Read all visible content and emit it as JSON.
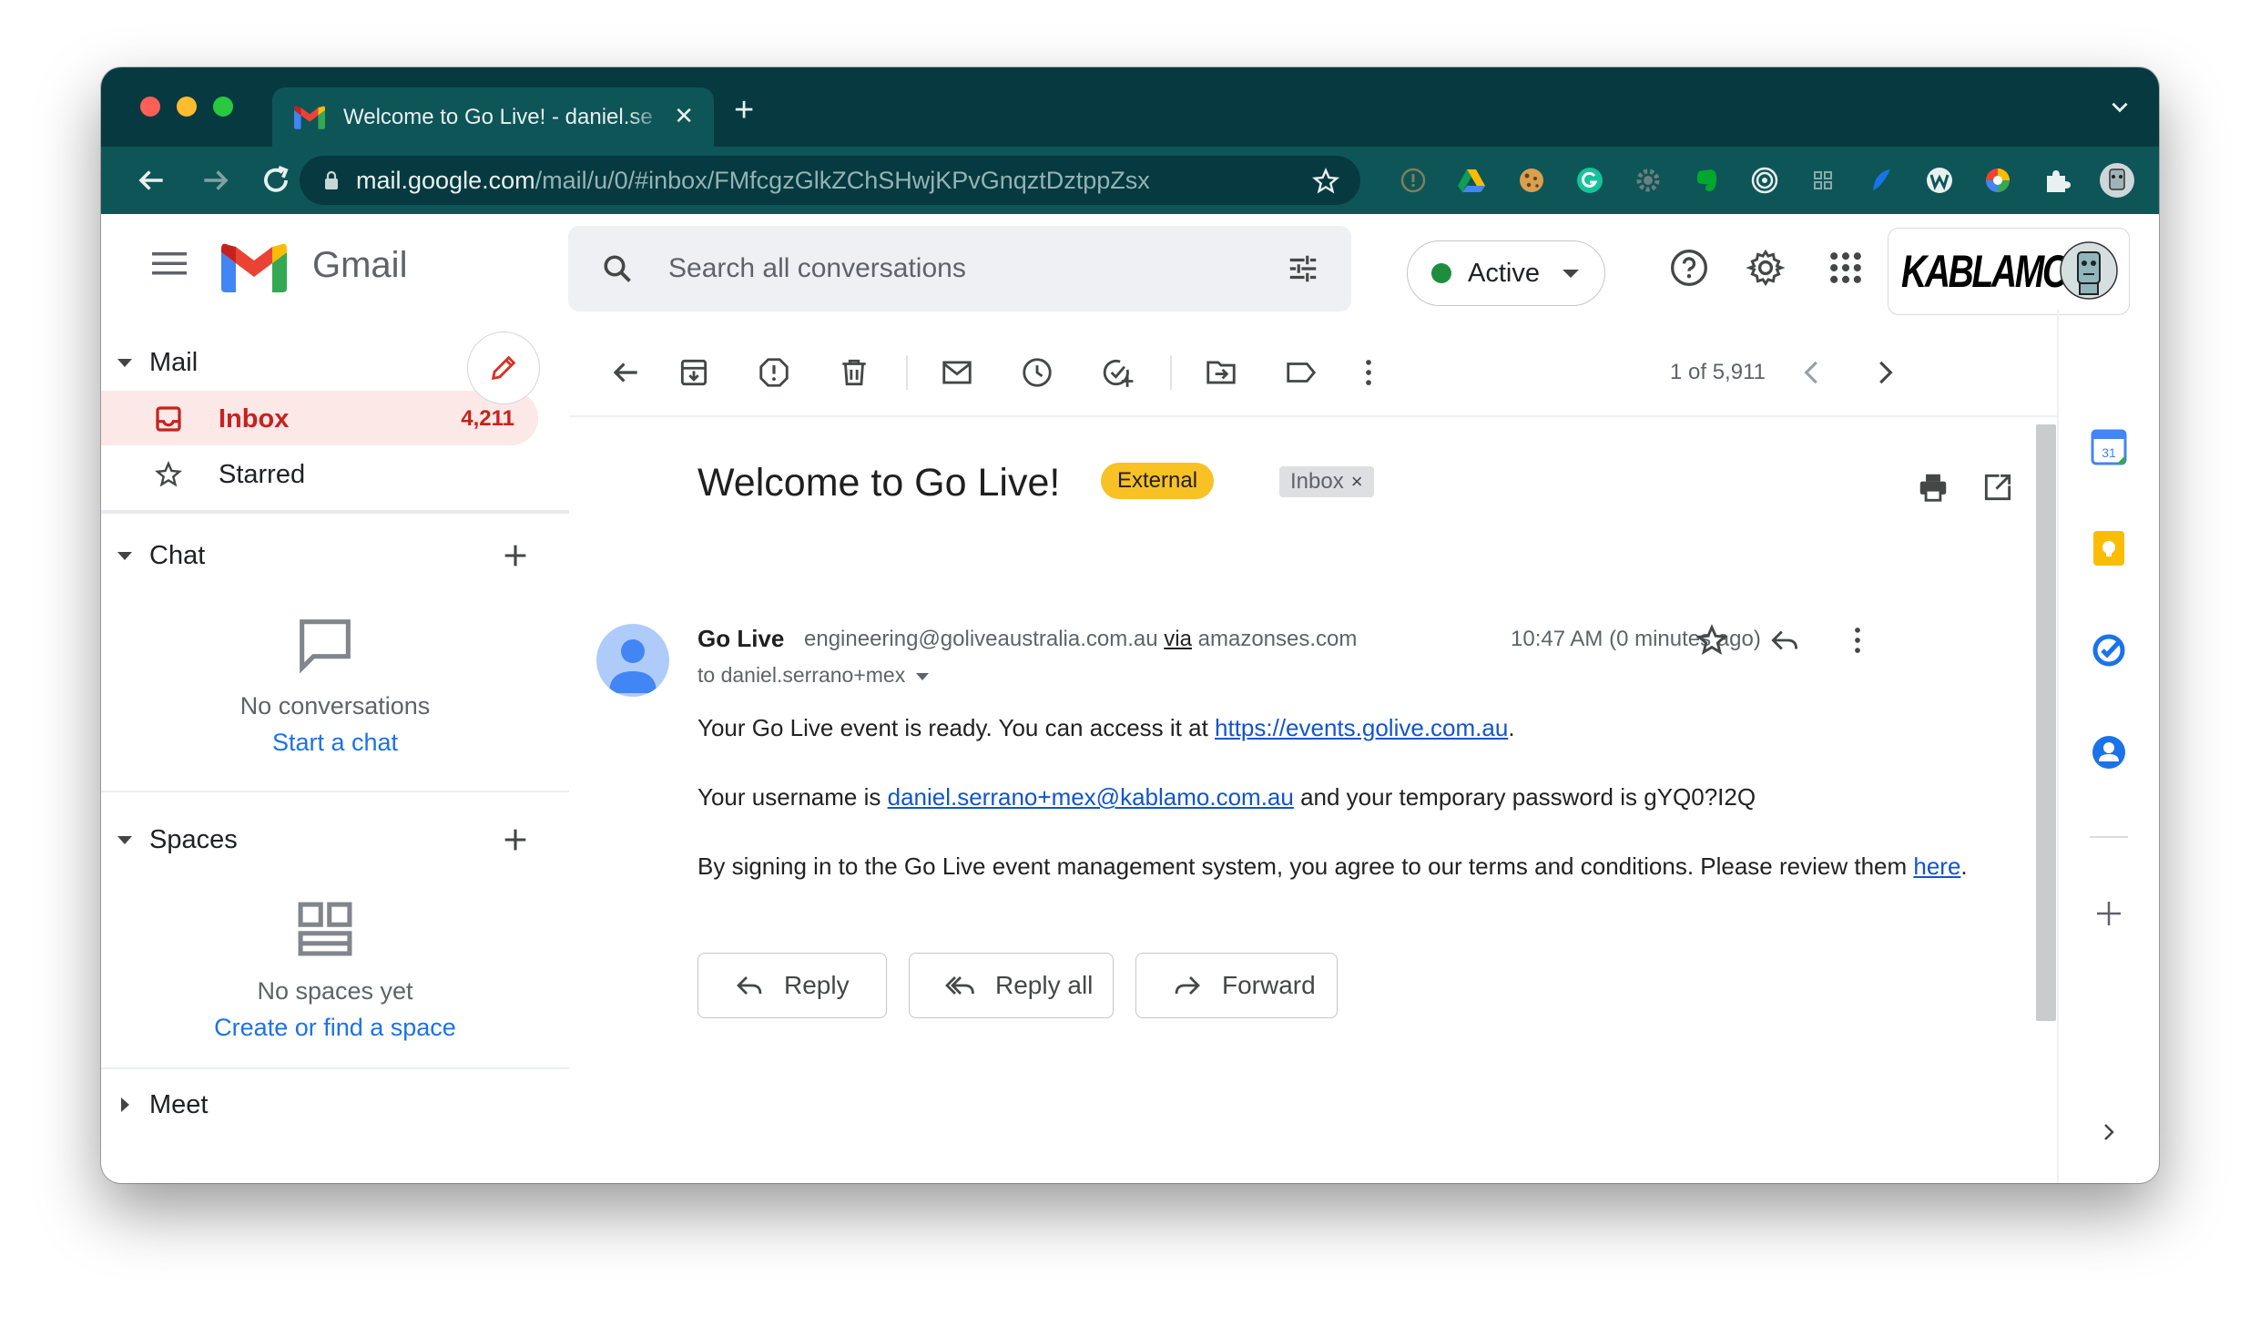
{
  "browser": {
    "tab_title": "Welcome to Go Live! - daniel.se",
    "new_tab_symbol": "+",
    "url_host": "mail.google.com",
    "url_path": "/mail/u/0/#inbox/FMfcgzGlkZChSHwjKPvGnqztDztppZsx"
  },
  "header": {
    "app_name": "Gmail",
    "search_placeholder": "Search all conversations",
    "status_label": "Active",
    "status_color": "#1e8e3e",
    "brand_text": "KABLAMO"
  },
  "sidebar": {
    "mail_section": "Mail",
    "items": [
      {
        "label": "Inbox",
        "count": "4,211",
        "icon": "inbox-icon"
      },
      {
        "label": "Starred",
        "icon": "star-icon"
      }
    ],
    "chat_section": "Chat",
    "chat_empty": "No conversations",
    "chat_link": "Start a chat",
    "spaces_section": "Spaces",
    "spaces_empty": "No spaces yet",
    "spaces_link": "Create or find a space",
    "meet_section": "Meet"
  },
  "toolbar": {
    "pager": "1 of 5,911"
  },
  "message": {
    "subject": "Welcome to Go Live!",
    "label_external": "External",
    "label_inbox": "Inbox",
    "label_remove": "×",
    "sender_name": "Go Live",
    "sender_email": "engineering@goliveaustralia.com.au",
    "via_word": "via",
    "via_domain": "amazonses.com",
    "to_line": "to daniel.serrano+mex",
    "time": "10:47 AM (0 minutes ago)",
    "p1_before": "Your Go Live event is ready. You can access it at ",
    "p1_link": "https://events.golive.com.au",
    "p1_after": ".",
    "p2_before": "Your username is ",
    "p2_link": "daniel.serrano+mex@kablamo.com.au",
    "p2_after": " and your temporary password is gYQ0?I2Q",
    "p3_before": "By signing in to the Go Live event management system, you agree to our terms and conditions. Please review them ",
    "p3_link": "here",
    "p3_after": "."
  },
  "actions": {
    "reply": "Reply",
    "reply_all": "Reply all",
    "forward": "Forward"
  },
  "colors": {
    "tabstrip": "#063a40",
    "toolbar": "#0e5558",
    "inbox_accent": "#c5221f",
    "label_external": "#f8c124",
    "link": "#1155cc"
  }
}
